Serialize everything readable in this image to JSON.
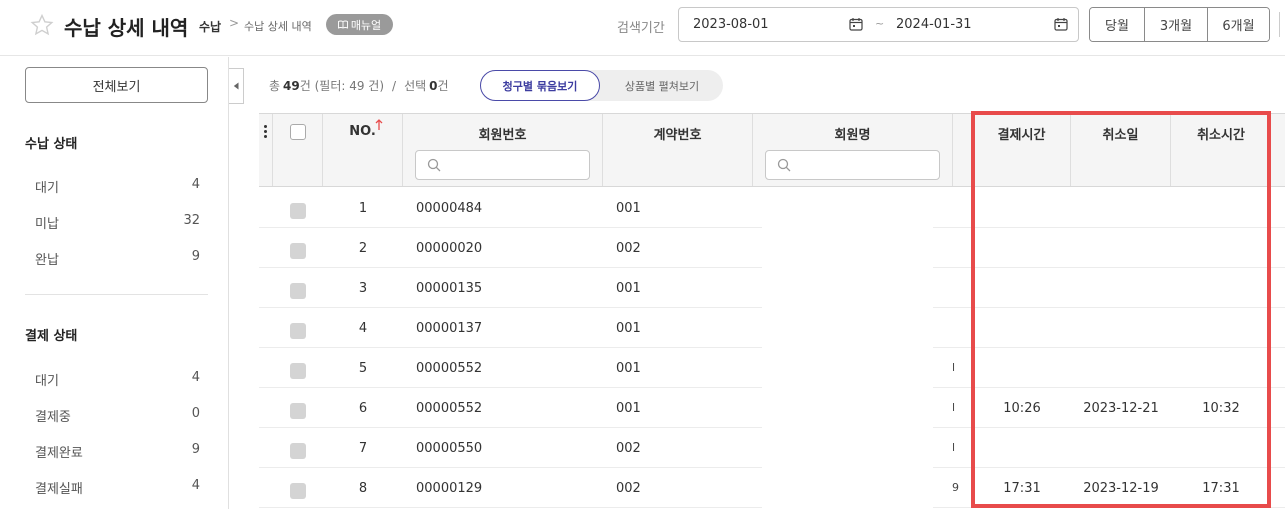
{
  "header": {
    "title": "수납 상세 내역",
    "breadcrumb": [
      "수납",
      "수납 상세 내역"
    ],
    "breadcrumb_separator": ">",
    "manual_label": "매뉴얼",
    "search_period_label": "검색기간",
    "date_from": "2023-08-01",
    "date_to": "2024-01-31",
    "date_separator": "~",
    "period_buttons": [
      "당월",
      "3개월",
      "6개월"
    ]
  },
  "sidebar": {
    "view_all_label": "전체보기",
    "payment_status": {
      "title": "수납 상태",
      "items": [
        {
          "label": "대기",
          "count": "4"
        },
        {
          "label": "미납",
          "count": "32"
        },
        {
          "label": "완납",
          "count": "9"
        }
      ]
    },
    "settlement_status": {
      "title": "결제 상태",
      "items": [
        {
          "label": "대기",
          "count": "4"
        },
        {
          "label": "결제중",
          "count": "0"
        },
        {
          "label": "결제완료",
          "count": "9"
        },
        {
          "label": "결제실패",
          "count": "4"
        }
      ]
    }
  },
  "summary": {
    "total_prefix": "총",
    "total_count": "49",
    "total_suffix": "건 (필터: 49 건)",
    "separator": "/",
    "selected_prefix": "선택",
    "selected_count": "0",
    "selected_suffix": "건"
  },
  "view_toggle": {
    "active": "청구별 묶음보기",
    "inactive": "상품별 펼쳐보기"
  },
  "table": {
    "columns": [
      "NO.",
      "회원번호",
      "계약번호",
      "회원명",
      "결제시간",
      "취소일",
      "취소시간"
    ],
    "rows": [
      {
        "no": "1",
        "member_no": "00000484",
        "contract_no": "001",
        "edge": "",
        "pay_time": "",
        "cancel_date": "",
        "cancel_time": ""
      },
      {
        "no": "2",
        "member_no": "00000020",
        "contract_no": "002",
        "edge": "",
        "pay_time": "",
        "cancel_date": "",
        "cancel_time": ""
      },
      {
        "no": "3",
        "member_no": "00000135",
        "contract_no": "001",
        "edge": "",
        "pay_time": "",
        "cancel_date": "",
        "cancel_time": ""
      },
      {
        "no": "4",
        "member_no": "00000137",
        "contract_no": "001",
        "edge": "",
        "pay_time": "",
        "cancel_date": "",
        "cancel_time": ""
      },
      {
        "no": "5",
        "member_no": "00000552",
        "contract_no": "001",
        "edge": "l",
        "pay_time": "",
        "cancel_date": "",
        "cancel_time": ""
      },
      {
        "no": "6",
        "member_no": "00000552",
        "contract_no": "001",
        "edge": "l",
        "pay_time": "10:26",
        "cancel_date": "2023-12-21",
        "cancel_time": "10:32"
      },
      {
        "no": "7",
        "member_no": "00000550",
        "contract_no": "002",
        "edge": "l",
        "pay_time": "",
        "cancel_date": "",
        "cancel_time": ""
      },
      {
        "no": "8",
        "member_no": "00000129",
        "contract_no": "002",
        "edge": "9",
        "pay_time": "17:31",
        "cancel_date": "2023-12-19",
        "cancel_time": "17:31"
      }
    ]
  },
  "colors": {
    "highlight": "#e84b4b",
    "toggle_accent": "#3d3da0",
    "badge_bg": "#9a9a9a",
    "sort_arrow": "#e84b4b"
  }
}
